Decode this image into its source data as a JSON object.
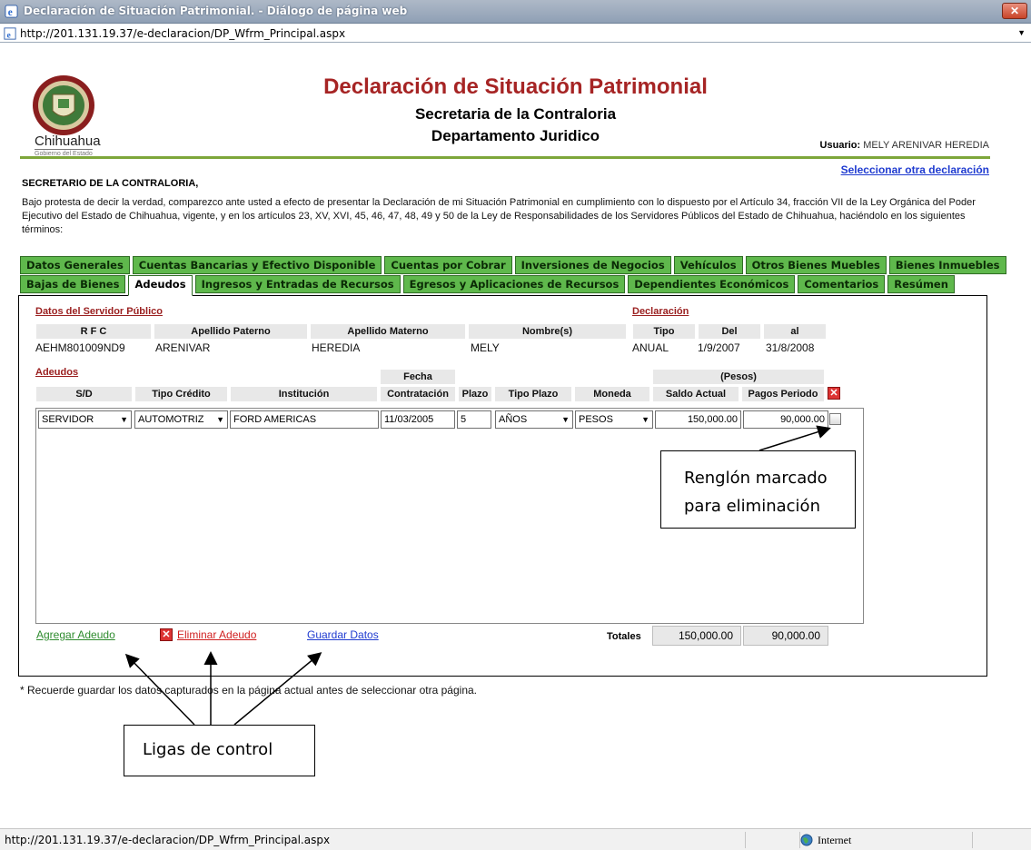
{
  "window": {
    "title": "Declaración de Situación Patrimonial. - Diálogo de página web",
    "close_label": "✕",
    "url": "http://201.131.19.37/e-declaracion/DP_Wfrm_Principal.aspx"
  },
  "header": {
    "logo_text": "Chihuahua",
    "logo_sub": "Gobierno del Estado",
    "title": "Declaración de Situación Patrimonial",
    "subtitle1": "Secretaria de la Contraloria",
    "subtitle2": "Departamento Juridico",
    "user_label": "Usuario:",
    "user_name": "MELY ARENIVAR HEREDIA",
    "select_link": "Seleccionar otra declaración"
  },
  "intro": {
    "addressee": "SECRETARIO DE LA CONTRALORIA,",
    "text": "Bajo protesta de decir la verdad, comparezco ante usted a efecto de presentar la Declaración de mi Situación Patrimonial en cumplimiento con lo dispuesto por el Artículo 34, fracción VII de la Ley Orgánica del Poder Ejecutivo del Estado de Chihuahua, vigente, y en los artículos 23, XV, XVI, 45, 46, 47, 48, 49 y 50 de la Ley de Responsabilidades de los Servidores Públicos del Estado de Chihuahua, haciéndolo en los siguientes términos:"
  },
  "tabs_row1": [
    "Datos Generales",
    "Cuentas Bancarias y Efectivo Disponible",
    "Cuentas por Cobrar",
    "Inversiones de Negocios",
    "Vehículos",
    "Otros Bienes Muebles",
    "Bienes Inmuebles"
  ],
  "tabs_row2": [
    "Bajas de Bienes",
    "Adeudos",
    "Ingresos y Entradas de Recursos",
    "Egresos y Aplicaciones de Recursos",
    "Dependientes Económicos",
    "Comentarios",
    "Resúmen"
  ],
  "active_tab": "Adeudos",
  "servidor": {
    "section": "Datos del Servidor Público",
    "headers": {
      "rfc": "R F C",
      "paterno": "Apellido Paterno",
      "materno": "Apellido Materno",
      "nombre": "Nombre(s)"
    },
    "values": {
      "rfc": "AEHM801009ND9",
      "paterno": "ARENIVAR",
      "materno": "HEREDIA",
      "nombre": "MELY"
    }
  },
  "declaracion": {
    "section": "Declaración",
    "headers": {
      "tipo": "Tipo",
      "del": "Del",
      "al": "al"
    },
    "values": {
      "tipo": "ANUAL",
      "del": "1/9/2007",
      "al": "31/8/2008"
    }
  },
  "adeudos": {
    "section": "Adeudos",
    "group_fecha": "Fecha",
    "group_pesos": "(Pesos)",
    "columns": [
      "S/D",
      "Tipo Crédito",
      "Institución",
      "Contratación",
      "Plazo",
      "Tipo Plazo",
      "Moneda",
      "Saldo Actual",
      "Pagos Periodo"
    ],
    "row": {
      "sd": "SERVIDOR",
      "tipo_credito": "AUTOMOTRIZ",
      "institucion": "FORD AMERICAS",
      "contratacion": "11/03/2005",
      "plazo": "5",
      "tipo_plazo": "AÑOS",
      "moneda": "PESOS",
      "saldo_actual": "150,000.00",
      "pagos_periodo": "90,000.00"
    },
    "totales_label": "Totales",
    "total_saldo": "150,000.00",
    "total_pagos": "90,000.00"
  },
  "controls": {
    "agregar": "Agregar Adeudo",
    "eliminar": "Eliminar Adeudo",
    "guardar": "Guardar Datos"
  },
  "footnote": "* Recuerde guardar los datos capturados en la página actual antes de seleccionar otra página.",
  "callouts": {
    "row_marked_line1": "Renglón marcado",
    "row_marked_line2": "para eliminación",
    "control_links": "Ligas de control"
  },
  "statusbar": {
    "url": "http://201.131.19.37/e-declaracion/DP_Wfrm_Principal.aspx",
    "zone": "Internet"
  },
  "colors": {
    "tab_green": "#5fb84c",
    "title_red": "#a62424",
    "link_blue": "#1f3bd0",
    "section_red": "#9a1f1f",
    "agregar_green": "#2e8b2e",
    "eliminar_red": "#d02020"
  }
}
